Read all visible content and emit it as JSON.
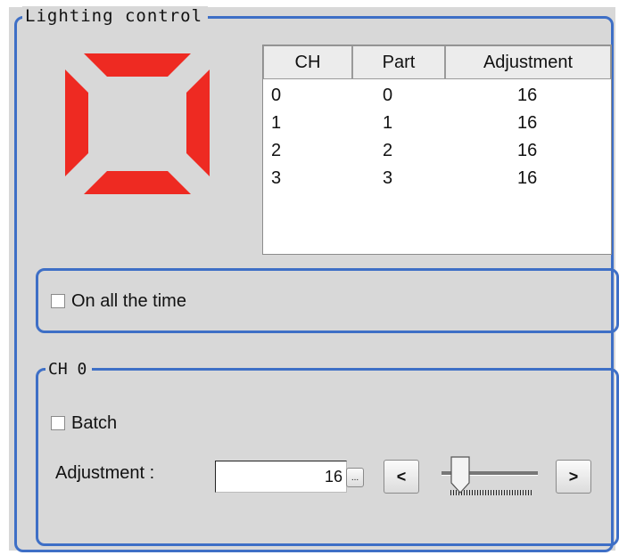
{
  "lighting_group": {
    "title": "Lighting control"
  },
  "channel_icon": {
    "color": "#ee2a22",
    "name": "square-segmented-light-icon"
  },
  "table": {
    "headers": [
      "CH",
      "Part",
      "Adjustment"
    ],
    "rows": [
      [
        "0",
        "0",
        "16"
      ],
      [
        "1",
        "1",
        "16"
      ],
      [
        "2",
        "2",
        "16"
      ],
      [
        "3",
        "3",
        "16"
      ]
    ]
  },
  "always_on": {
    "label": "On all the time",
    "checked": false
  },
  "channel_group": {
    "title": "CH 0",
    "batch_label": "Batch",
    "batch_checked": false,
    "adjustment_label": "Adjustment :",
    "adjustment_value": "16",
    "ellipsis_label": "...",
    "decrement_label": "<",
    "increment_label": ">",
    "slider_fraction": 0.0
  },
  "colors": {
    "group_border": "#3e6fc6",
    "panel_bg": "#d8d8d8",
    "lamp_red": "#ee2a22"
  }
}
